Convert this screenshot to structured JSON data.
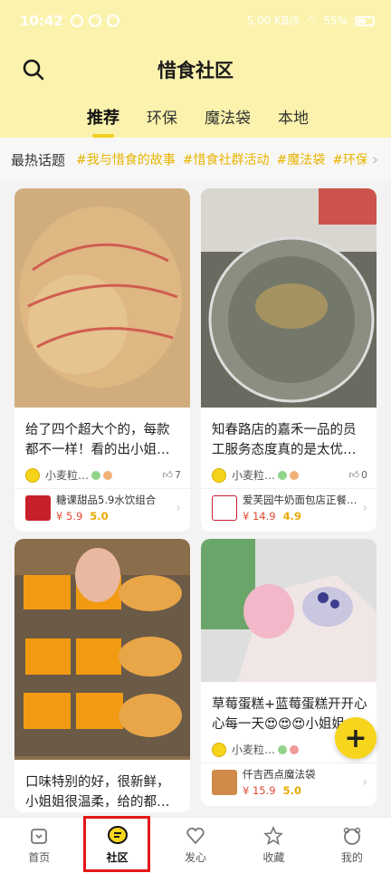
{
  "status": {
    "time": "10:42",
    "network": "5.00 KB/S",
    "battery": "55%"
  },
  "header": {
    "title": "惜食社区"
  },
  "tabs": [
    "推荐",
    "环保",
    "魔法袋",
    "本地"
  ],
  "topics": {
    "label": "最热话题",
    "tags": [
      "#我与惜食的故事",
      "#惜食社群活动",
      "#魔法袋",
      "#环保"
    ]
  },
  "cards": {
    "c1": {
      "title": "给了四个超大个的，每款都不一样！看的出小姐…",
      "user": "小麦粒…",
      "likes": "7",
      "shop": "糖课甜品5.9水饮组合",
      "price": "¥ 5.9",
      "rating": "5.0"
    },
    "c2": {
      "title": "知春路店的嘉禾一品的员工服务态度真的是太优…",
      "user": "小麦粒…",
      "likes": "0",
      "shop": "爱芙园牛奶面包店正餐…",
      "price": "¥ 14.9",
      "rating": "4.9"
    },
    "c3": {
      "title": "口味特别的好，很新鲜，小姐姐很温柔，给的都…"
    },
    "c4": {
      "title": "草莓蛋糕+蓝莓蛋糕开开心心每一天😍😍😍小姐姐…",
      "user": "小麦粒…",
      "shop": "仟吉西点魔法袋",
      "price": "¥ 15.9",
      "rating": "5.0"
    }
  },
  "nav": [
    "首页",
    "社区",
    "发心",
    "收藏",
    "我的"
  ],
  "colors": {
    "brand_yellow": "#f7d51c",
    "header_bg": "#fbf3ad",
    "accent": "#e8b400",
    "price": "#e04a2f",
    "highlight": "#e31818"
  }
}
